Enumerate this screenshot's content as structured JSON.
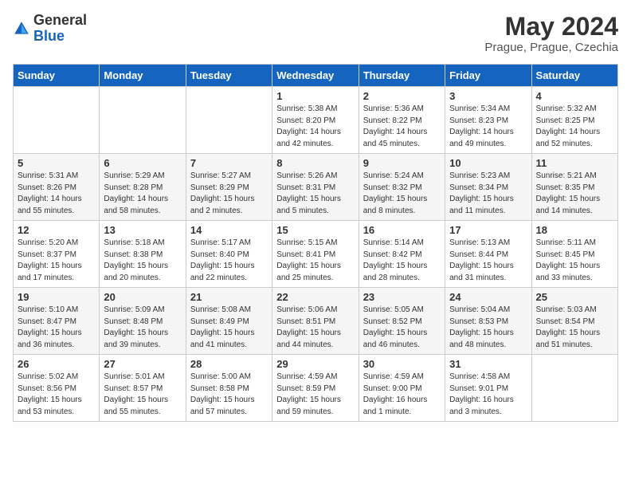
{
  "header": {
    "logo_general": "General",
    "logo_blue": "Blue",
    "title": "May 2024",
    "subtitle": "Prague, Prague, Czechia"
  },
  "days_of_week": [
    "Sunday",
    "Monday",
    "Tuesday",
    "Wednesday",
    "Thursday",
    "Friday",
    "Saturday"
  ],
  "weeks": [
    [
      {
        "day": "",
        "info": ""
      },
      {
        "day": "",
        "info": ""
      },
      {
        "day": "",
        "info": ""
      },
      {
        "day": "1",
        "info": "Sunrise: 5:38 AM\nSunset: 8:20 PM\nDaylight: 14 hours\nand 42 minutes."
      },
      {
        "day": "2",
        "info": "Sunrise: 5:36 AM\nSunset: 8:22 PM\nDaylight: 14 hours\nand 45 minutes."
      },
      {
        "day": "3",
        "info": "Sunrise: 5:34 AM\nSunset: 8:23 PM\nDaylight: 14 hours\nand 49 minutes."
      },
      {
        "day": "4",
        "info": "Sunrise: 5:32 AM\nSunset: 8:25 PM\nDaylight: 14 hours\nand 52 minutes."
      }
    ],
    [
      {
        "day": "5",
        "info": "Sunrise: 5:31 AM\nSunset: 8:26 PM\nDaylight: 14 hours\nand 55 minutes."
      },
      {
        "day": "6",
        "info": "Sunrise: 5:29 AM\nSunset: 8:28 PM\nDaylight: 14 hours\nand 58 minutes."
      },
      {
        "day": "7",
        "info": "Sunrise: 5:27 AM\nSunset: 8:29 PM\nDaylight: 15 hours\nand 2 minutes."
      },
      {
        "day": "8",
        "info": "Sunrise: 5:26 AM\nSunset: 8:31 PM\nDaylight: 15 hours\nand 5 minutes."
      },
      {
        "day": "9",
        "info": "Sunrise: 5:24 AM\nSunset: 8:32 PM\nDaylight: 15 hours\nand 8 minutes."
      },
      {
        "day": "10",
        "info": "Sunrise: 5:23 AM\nSunset: 8:34 PM\nDaylight: 15 hours\nand 11 minutes."
      },
      {
        "day": "11",
        "info": "Sunrise: 5:21 AM\nSunset: 8:35 PM\nDaylight: 15 hours\nand 14 minutes."
      }
    ],
    [
      {
        "day": "12",
        "info": "Sunrise: 5:20 AM\nSunset: 8:37 PM\nDaylight: 15 hours\nand 17 minutes."
      },
      {
        "day": "13",
        "info": "Sunrise: 5:18 AM\nSunset: 8:38 PM\nDaylight: 15 hours\nand 20 minutes."
      },
      {
        "day": "14",
        "info": "Sunrise: 5:17 AM\nSunset: 8:40 PM\nDaylight: 15 hours\nand 22 minutes."
      },
      {
        "day": "15",
        "info": "Sunrise: 5:15 AM\nSunset: 8:41 PM\nDaylight: 15 hours\nand 25 minutes."
      },
      {
        "day": "16",
        "info": "Sunrise: 5:14 AM\nSunset: 8:42 PM\nDaylight: 15 hours\nand 28 minutes."
      },
      {
        "day": "17",
        "info": "Sunrise: 5:13 AM\nSunset: 8:44 PM\nDaylight: 15 hours\nand 31 minutes."
      },
      {
        "day": "18",
        "info": "Sunrise: 5:11 AM\nSunset: 8:45 PM\nDaylight: 15 hours\nand 33 minutes."
      }
    ],
    [
      {
        "day": "19",
        "info": "Sunrise: 5:10 AM\nSunset: 8:47 PM\nDaylight: 15 hours\nand 36 minutes."
      },
      {
        "day": "20",
        "info": "Sunrise: 5:09 AM\nSunset: 8:48 PM\nDaylight: 15 hours\nand 39 minutes."
      },
      {
        "day": "21",
        "info": "Sunrise: 5:08 AM\nSunset: 8:49 PM\nDaylight: 15 hours\nand 41 minutes."
      },
      {
        "day": "22",
        "info": "Sunrise: 5:06 AM\nSunset: 8:51 PM\nDaylight: 15 hours\nand 44 minutes."
      },
      {
        "day": "23",
        "info": "Sunrise: 5:05 AM\nSunset: 8:52 PM\nDaylight: 15 hours\nand 46 minutes."
      },
      {
        "day": "24",
        "info": "Sunrise: 5:04 AM\nSunset: 8:53 PM\nDaylight: 15 hours\nand 48 minutes."
      },
      {
        "day": "25",
        "info": "Sunrise: 5:03 AM\nSunset: 8:54 PM\nDaylight: 15 hours\nand 51 minutes."
      }
    ],
    [
      {
        "day": "26",
        "info": "Sunrise: 5:02 AM\nSunset: 8:56 PM\nDaylight: 15 hours\nand 53 minutes."
      },
      {
        "day": "27",
        "info": "Sunrise: 5:01 AM\nSunset: 8:57 PM\nDaylight: 15 hours\nand 55 minutes."
      },
      {
        "day": "28",
        "info": "Sunrise: 5:00 AM\nSunset: 8:58 PM\nDaylight: 15 hours\nand 57 minutes."
      },
      {
        "day": "29",
        "info": "Sunrise: 4:59 AM\nSunset: 8:59 PM\nDaylight: 15 hours\nand 59 minutes."
      },
      {
        "day": "30",
        "info": "Sunrise: 4:59 AM\nSunset: 9:00 PM\nDaylight: 16 hours\nand 1 minute."
      },
      {
        "day": "31",
        "info": "Sunrise: 4:58 AM\nSunset: 9:01 PM\nDaylight: 16 hours\nand 3 minutes."
      },
      {
        "day": "",
        "info": ""
      }
    ]
  ]
}
